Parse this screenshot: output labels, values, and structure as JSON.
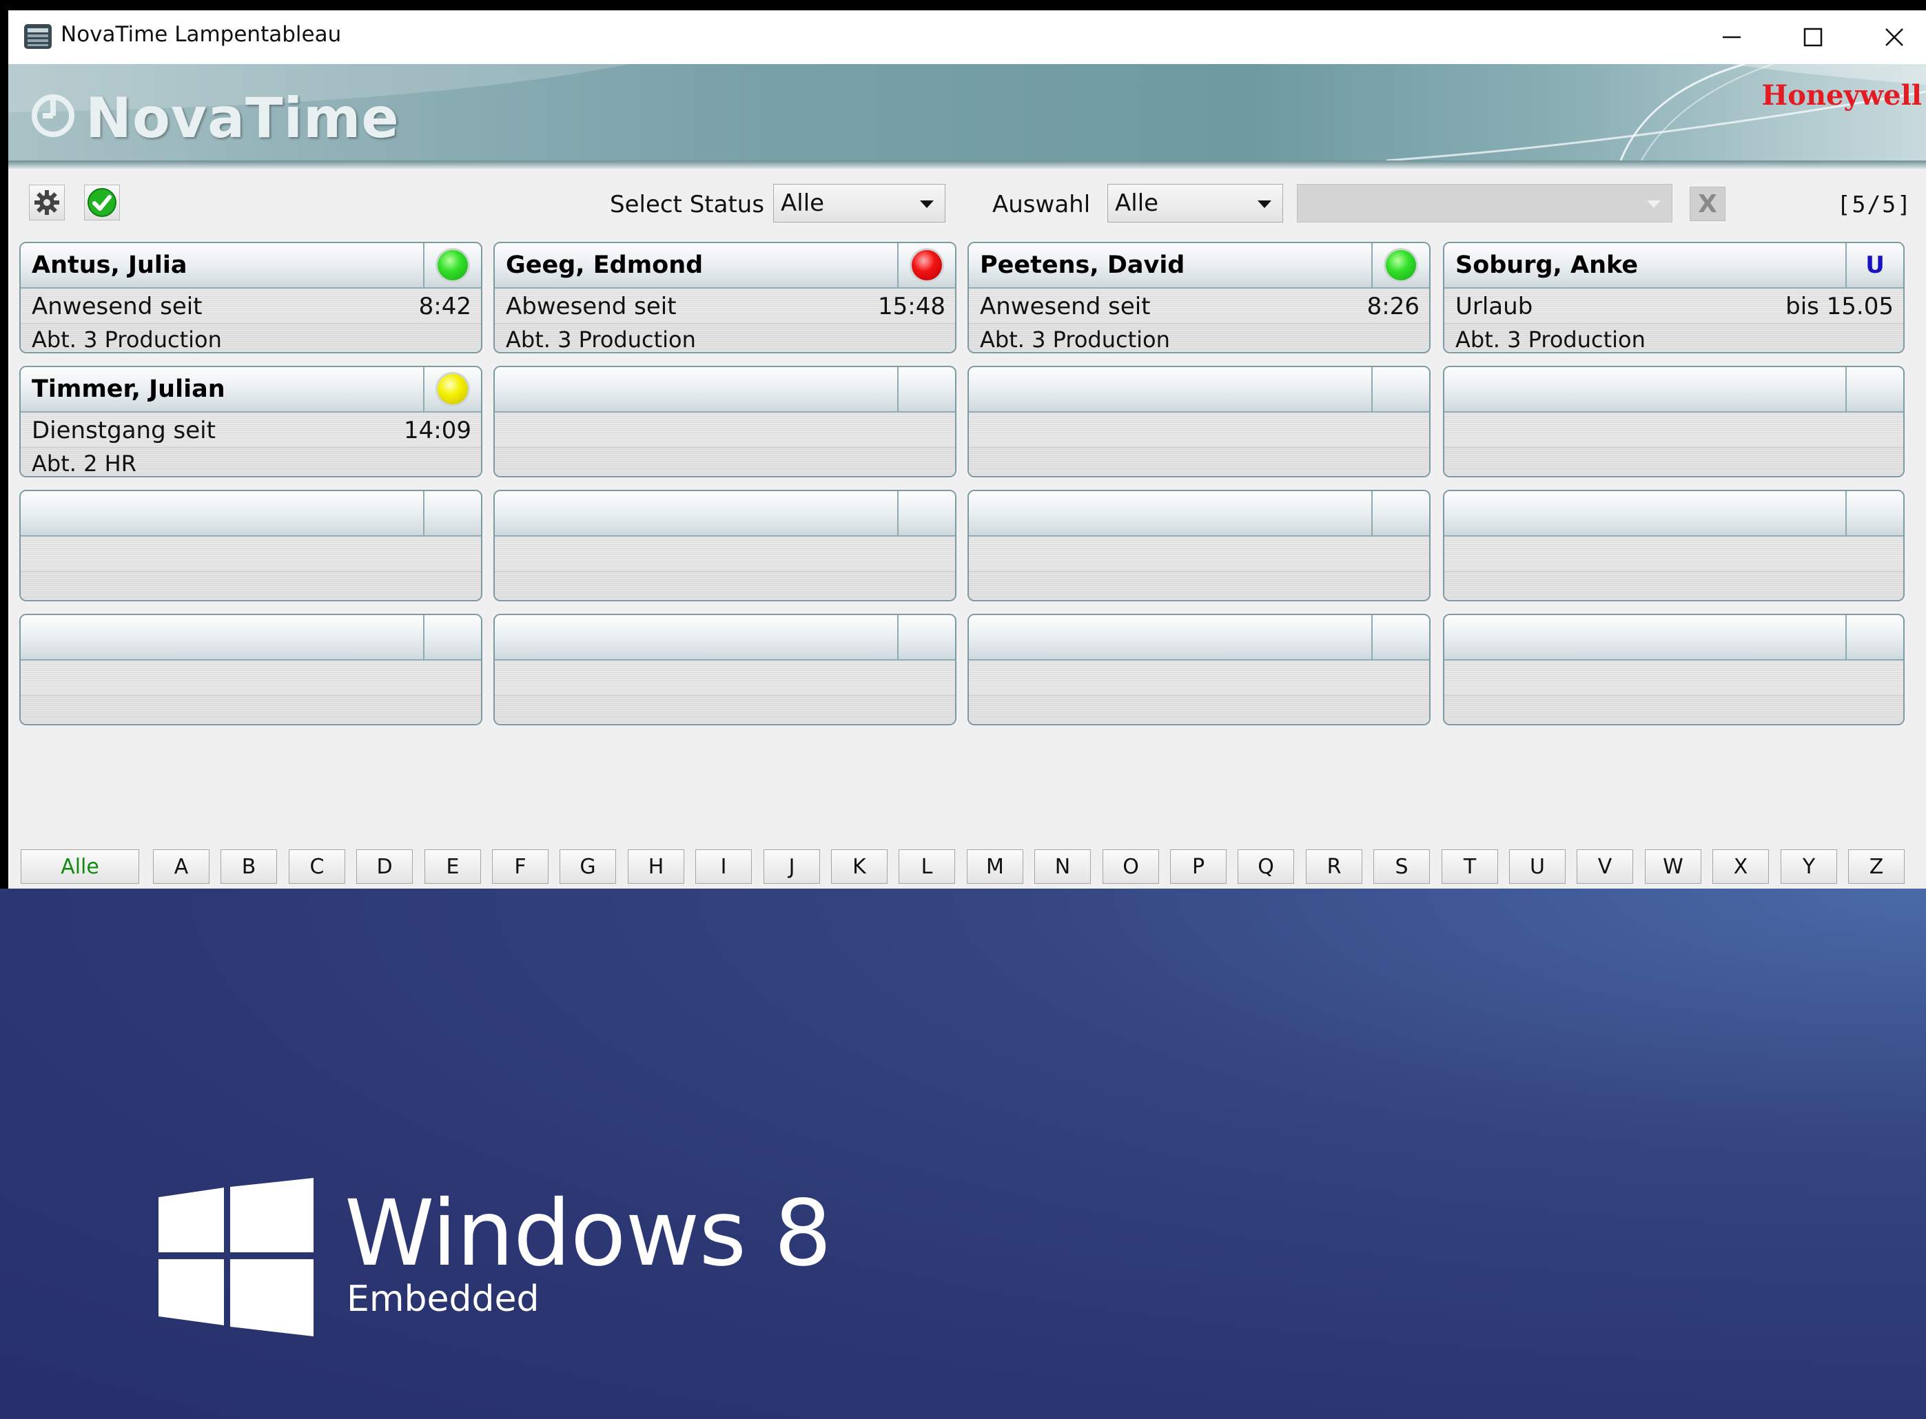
{
  "window": {
    "title": "NovaTime Lampentableau",
    "controls": [
      "minimize",
      "maximize",
      "close"
    ]
  },
  "banner": {
    "logo_text": "NovaTime",
    "brand": "Honeywell"
  },
  "toolbar": {
    "select_status_label": "Select Status",
    "select_status_value": "Alle",
    "auswahl_label": "Auswahl",
    "auswahl_value": "Alle",
    "extra_select_value": "",
    "clear_label": "X",
    "counter": "[5/5]"
  },
  "cards": [
    {
      "name": "Antus, Julia",
      "status": "Anwesend seit",
      "time": "8:42",
      "dept": "Abt. 3 Production",
      "lamp": "green",
      "lamp_letter": ""
    },
    {
      "name": "Geeg, Edmond",
      "status": "Abwesend seit",
      "time": "15:48",
      "dept": "Abt. 3 Production",
      "lamp": "red",
      "lamp_letter": ""
    },
    {
      "name": "Peetens, David",
      "status": "Anwesend seit",
      "time": "8:26",
      "dept": "Abt. 3 Production",
      "lamp": "green",
      "lamp_letter": ""
    },
    {
      "name": "Soburg, Anke",
      "status": "Urlaub",
      "time": "bis 15.05",
      "dept": "Abt. 3 Production",
      "lamp": "letter",
      "lamp_letter": "U"
    },
    {
      "name": "Timmer, Julian",
      "status": "Dienstgang seit",
      "time": "14:09",
      "dept": "Abt. 2 HR",
      "lamp": "yellow",
      "lamp_letter": ""
    }
  ],
  "alphabet": {
    "all_label": "Alle",
    "letters": [
      "A",
      "B",
      "C",
      "D",
      "E",
      "F",
      "G",
      "H",
      "I",
      "J",
      "K",
      "L",
      "M",
      "N",
      "O",
      "P",
      "Q",
      "R",
      "S",
      "T",
      "U",
      "V",
      "W",
      "X",
      "Y",
      "Z"
    ]
  },
  "desktop": {
    "os_title": "Windows 8",
    "os_sub": "Embedded"
  },
  "colors": {
    "brand_red": "#e31b23",
    "desktop_blue": "#2b3672",
    "lamp_green": "#33e02a",
    "lamp_red": "#f21414",
    "lamp_yellow": "#f4f000",
    "active_letter": "#108a10"
  }
}
